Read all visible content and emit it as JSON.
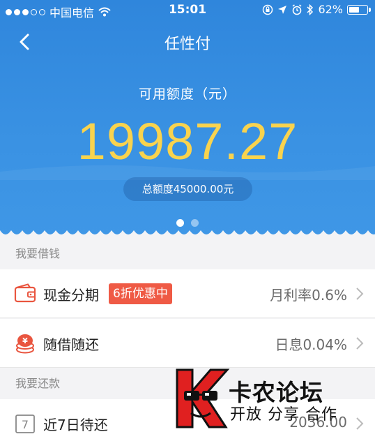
{
  "status_bar": {
    "carrier": "中国电信",
    "time": "15:01",
    "battery": "62%",
    "battery_level": 0.62
  },
  "nav": {
    "title": "任性付"
  },
  "summary": {
    "available_label": "可用额度（元）",
    "available_amount": "19987.27",
    "total_label": "总额度45000.00元",
    "pages": 2,
    "active_page": 1
  },
  "borrow_section": {
    "header": "我要借钱",
    "items": [
      {
        "title": "现金分期",
        "badge": "6折优惠中",
        "value": "月利率0.6%",
        "icon": "wallet-icon"
      },
      {
        "title": "随借随还",
        "value": "日息0.04%",
        "icon": "coins-icon"
      }
    ]
  },
  "repay_section": {
    "header": "我要还款",
    "items": [
      {
        "title": "近7日待还",
        "value": "2036.00",
        "icon": "calendar-7-icon",
        "icon_text": "7"
      }
    ]
  },
  "watermark": {
    "line1": "卡农论坛",
    "line2": "开放 分享 合作"
  },
  "colors": {
    "primary_blue": "#3a92e3",
    "amount_yellow": "#f9d34e",
    "badge_red": "#ef5a45",
    "icon_red": "#e9553f"
  }
}
